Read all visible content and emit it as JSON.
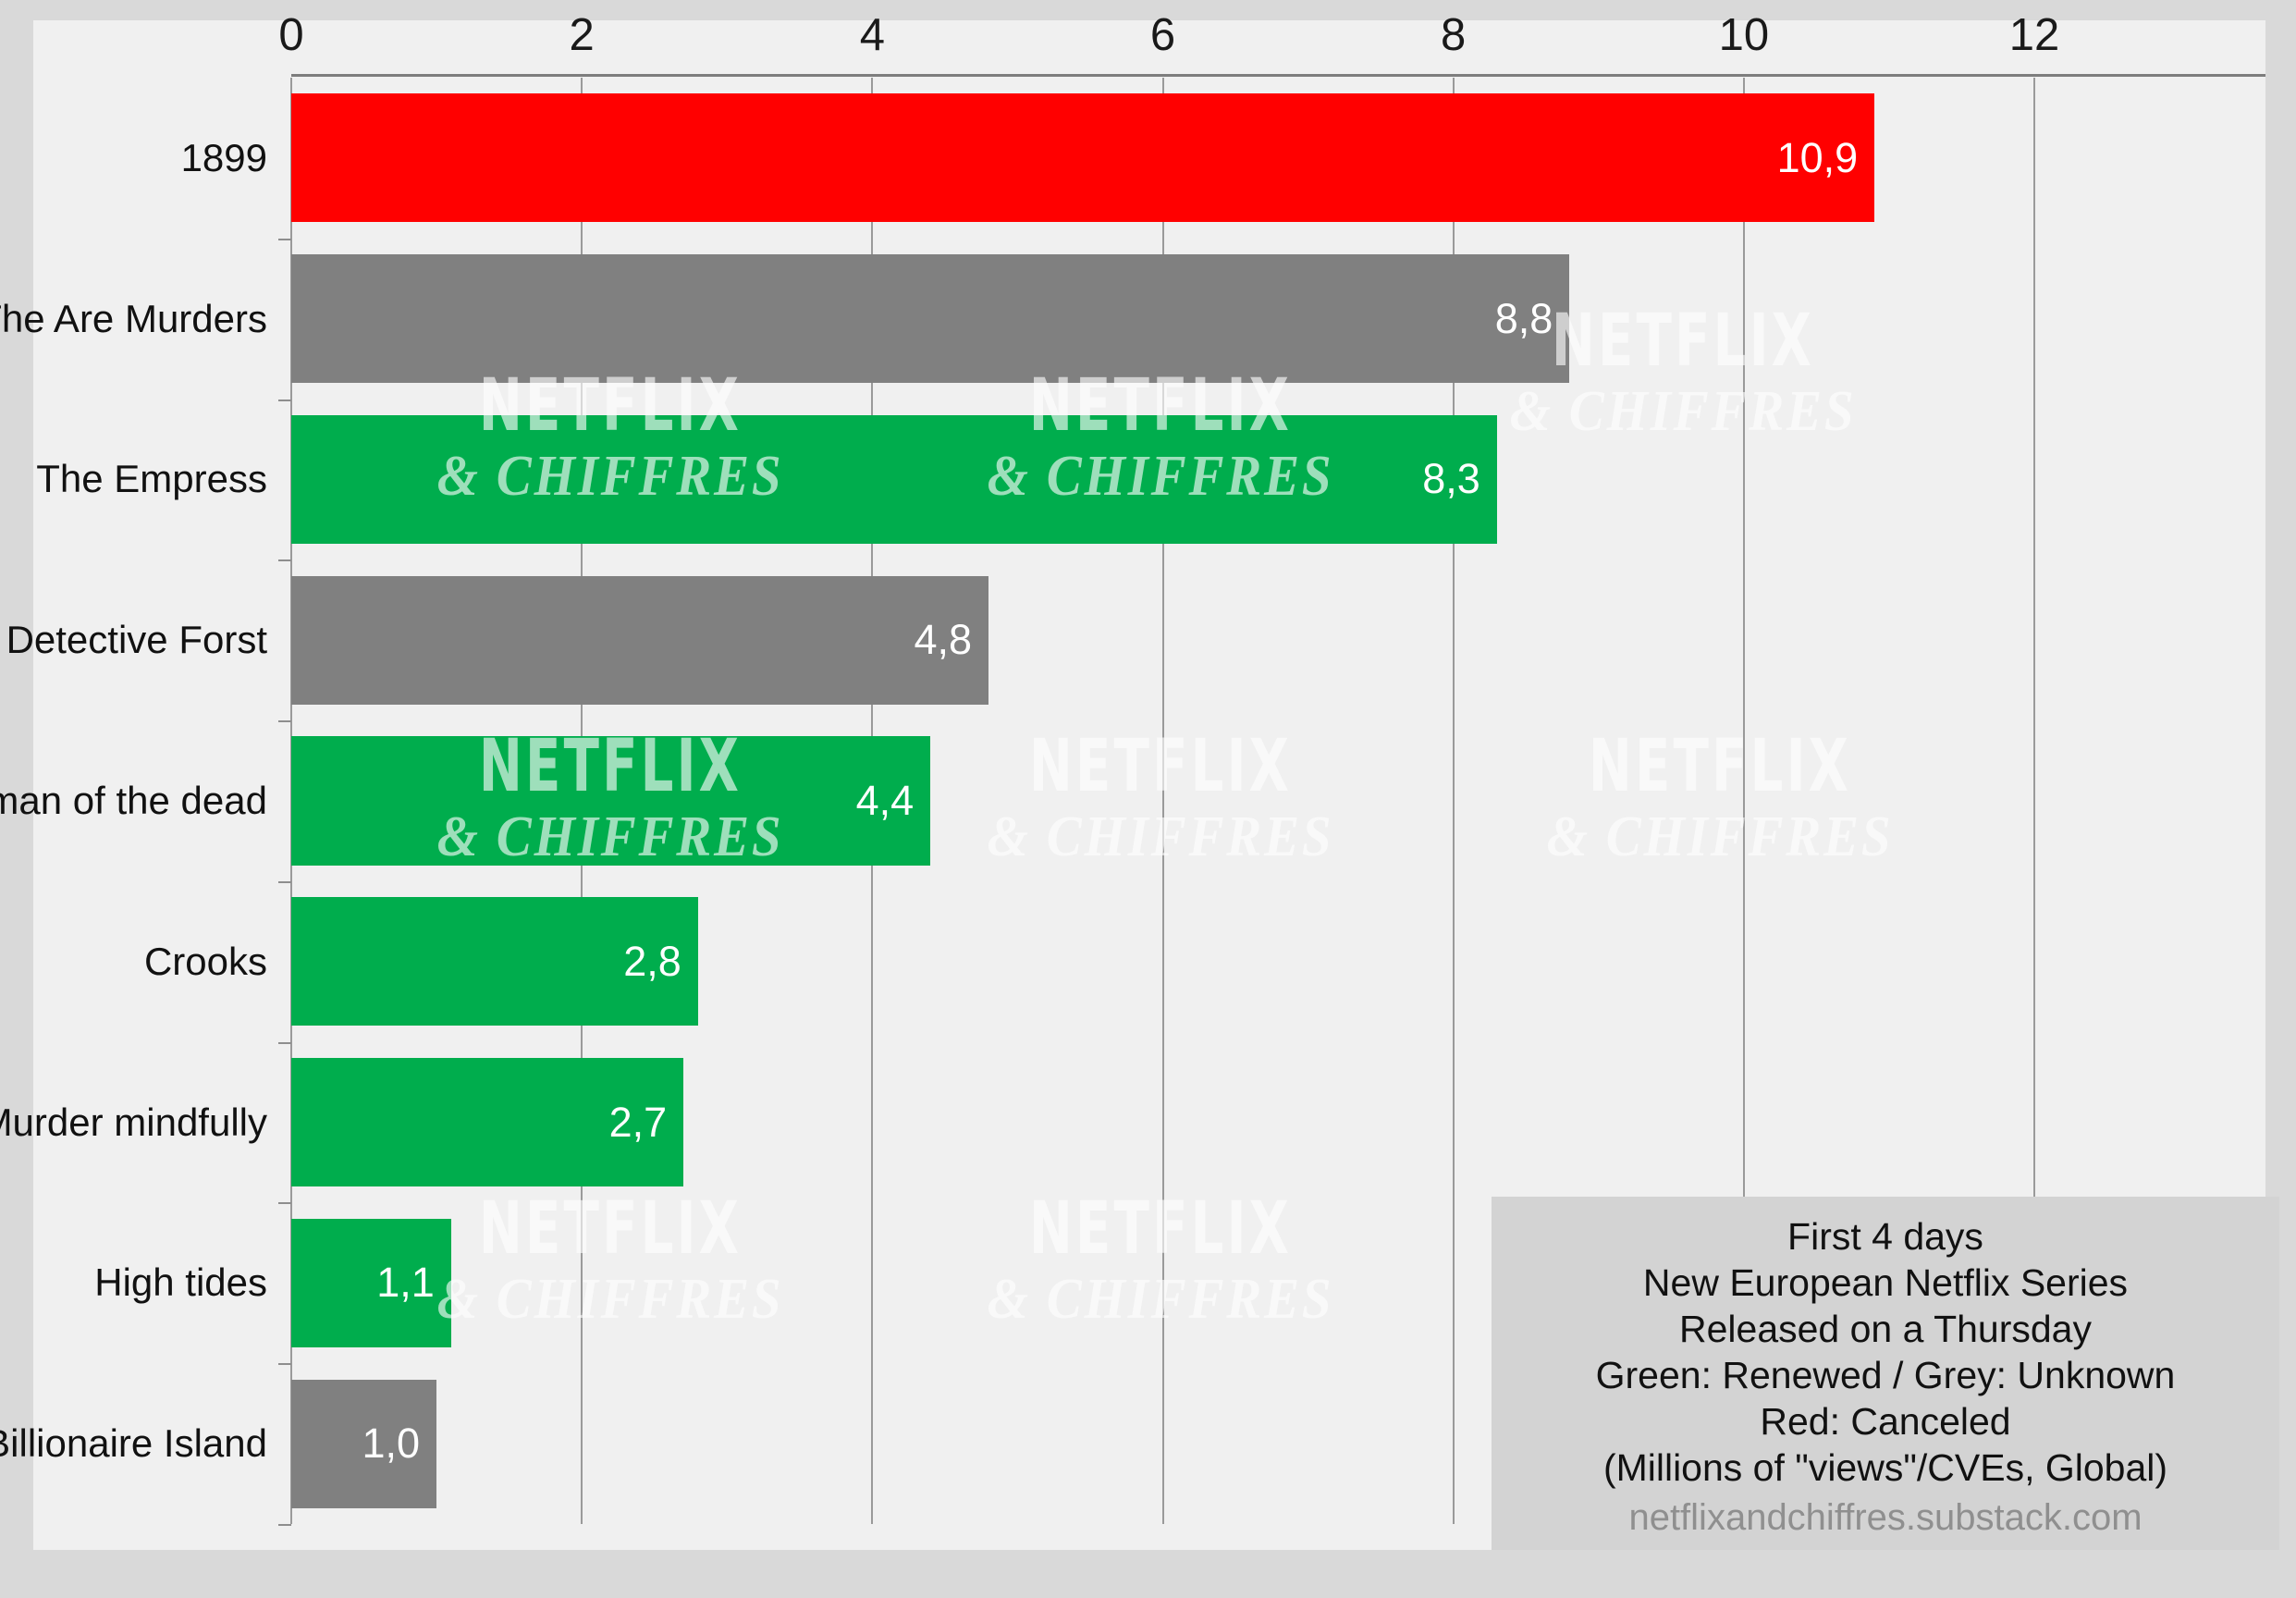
{
  "chart_data": {
    "type": "bar",
    "orientation": "horizontal",
    "title": "",
    "xlabel": "",
    "ylabel": "",
    "xlim": [
      0,
      12
    ],
    "xticks": [
      "0",
      "2",
      "4",
      "6",
      "8",
      "10",
      "12"
    ],
    "grid": "vertical",
    "legend_position": "bottom-right",
    "categories": [
      "1899",
      "The Are Murders",
      "The Empress",
      "Detective Forst",
      "Woman of the dead",
      "Crooks",
      "Murder mindfully",
      "High tides",
      "Billionaire Island"
    ],
    "values": [
      10.9,
      8.8,
      8.3,
      4.8,
      4.4,
      2.8,
      2.7,
      1.1,
      1.0
    ],
    "value_labels": [
      "10,9",
      "8,8",
      "8,3",
      "4,8",
      "4,4",
      "2,8",
      "2,7",
      "1,1",
      "1,0"
    ],
    "bar_colors": [
      "#ff0000",
      "#808080",
      "#00ad4d",
      "#808080",
      "#00ad4d",
      "#00ad4d",
      "#00ad4d",
      "#00ad4d",
      "#808080"
    ],
    "status": [
      "Canceled",
      "Unknown",
      "Renewed",
      "Unknown",
      "Renewed",
      "Renewed",
      "Renewed",
      "Renewed",
      "Unknown"
    ]
  },
  "colors": {
    "canceled_red": "#ff0000",
    "unknown_grey": "#808080",
    "renewed_green": "#00ad4d",
    "panel_background": "#f0f0f0",
    "page_background": "#d9d9d9",
    "note_background": "#d3d3d3",
    "gridline": "#9a9a9a"
  },
  "note": {
    "lines": [
      "First 4 days",
      "New European Netflix Series",
      "Released on a Thursday",
      "Green: Renewed / Grey: Unknown",
      "Red: Canceled",
      "(Millions of \"views\"/CVEs, Global)"
    ],
    "url": "netflixandchiffres.substack.com"
  },
  "watermark": {
    "main": "NETFLIX",
    "sub": "& CHIFFRES"
  }
}
